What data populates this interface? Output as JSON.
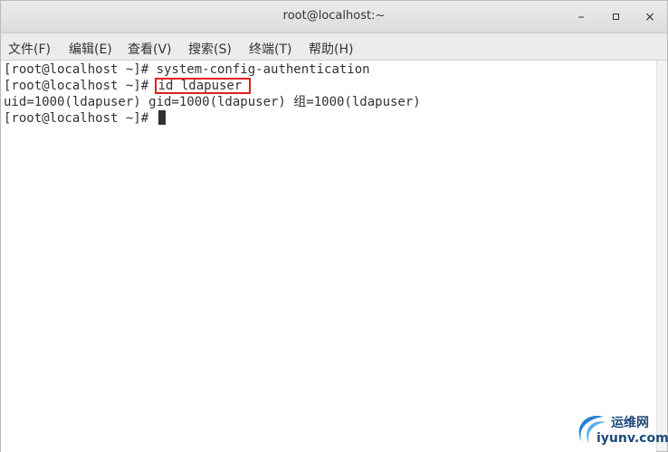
{
  "window": {
    "title": "root@localhost:~",
    "controls": {
      "minimize": "–",
      "close": "×"
    }
  },
  "menubar": {
    "items": [
      {
        "label": "文件(F)"
      },
      {
        "label": "编辑(E)"
      },
      {
        "label": "查看(V)"
      },
      {
        "label": "搜索(S)"
      },
      {
        "label": "终端(T)"
      },
      {
        "label": "帮助(H)"
      }
    ]
  },
  "terminal": {
    "lines": [
      {
        "prompt": "[root@localhost ~]# ",
        "command": "system-config-authentication"
      },
      {
        "prompt": "[root@localhost ~]# ",
        "command": "id ldapuser"
      },
      {
        "output": "uid=1000(ldapuser) gid=1000(ldapuser) 组=1000(ldapuser)"
      },
      {
        "prompt": "[root@localhost ~]# ",
        "command": ""
      }
    ],
    "highlight_color": "#e02020"
  },
  "watermark": {
    "top_text": "运维网",
    "bottom_text": "iyunv.com"
  }
}
